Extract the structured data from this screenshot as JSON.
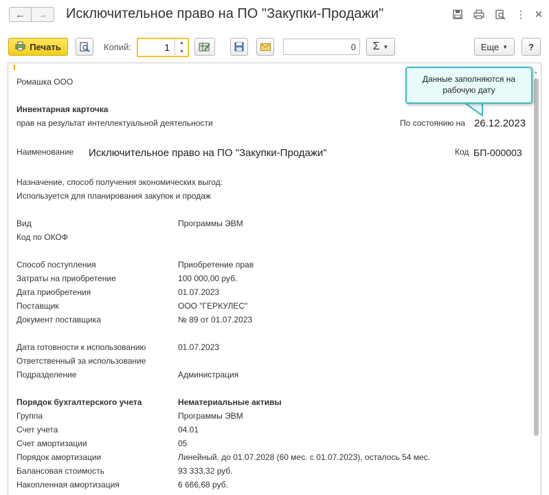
{
  "window": {
    "title": "Исключительное право на ПО \"Закупки-Продажи\""
  },
  "toolbar": {
    "print_label": "Печать",
    "copies_label": "Копий:",
    "copies_value": "1",
    "sum_value": "0",
    "more_label": "Еще",
    "help_label": "?",
    "sum_symbol": "Σ"
  },
  "callout": {
    "line1": "Данные заполняются на",
    "line2": "рабочую дату"
  },
  "document": {
    "organization": "Ромашка ООО",
    "card_title": "Инвентарная карточка",
    "card_subtitle": "прав на результат интеллектуальной деятельности",
    "as_of_label": "По состоянию на",
    "as_of_date": "26.12.2023",
    "name_label": "Наименование",
    "name_value": "Исключительное право на ПО \"Закупки-Продажи\"",
    "code_label": "Код",
    "code_value": "БП-000003",
    "purpose_label": "Назначение, способ получения экономических выгод:",
    "purpose_value": "Используется для планирования закупок и продаж",
    "rows": [
      {
        "label": "Вид",
        "value": "Программы ЭВМ"
      },
      {
        "label": "Код по ОКОФ",
        "value": ""
      },
      {
        "label": "Способ поступления",
        "value": "Приобретение прав"
      },
      {
        "label": "Затраты на приобретение",
        "value": "100 000,00 руб."
      },
      {
        "label": "Дата приобретения",
        "value": "01.07.2023"
      },
      {
        "label": "Поставщик",
        "value": "ООО \"ГЕРКУЛЕС\""
      },
      {
        "label": "Документ поставщика",
        "value": "№ 89 от 01.07.2023"
      },
      {
        "label": "Дата готовности к использованию",
        "value": "01.07.2023"
      },
      {
        "label": "Ответственный за использование",
        "value": ""
      },
      {
        "label": "Подразделение",
        "value": "Администрация"
      },
      {
        "label": "Порядок бухгалтерского учета",
        "value": "Нематериальные активы"
      },
      {
        "label": "Группа",
        "value": "Программы ЭВМ"
      },
      {
        "label": "Счет учета",
        "value": "04.01"
      },
      {
        "label": "Счет амортизации",
        "value": "05"
      },
      {
        "label": "Порядок амортизации",
        "value": "Линейный, до 01.07.2028 (60 мес. с 01.07.2023), осталось 54 мес."
      },
      {
        "label": "Балансовая стоимость",
        "value": "93 333,32 руб."
      },
      {
        "label": "Накопленная амортизация",
        "value": "6 666,68 руб."
      }
    ]
  },
  "colors": {
    "print_button": "#f3cf1a",
    "callout_border": "#3bb9c0",
    "focus_border": "#f0b400"
  }
}
